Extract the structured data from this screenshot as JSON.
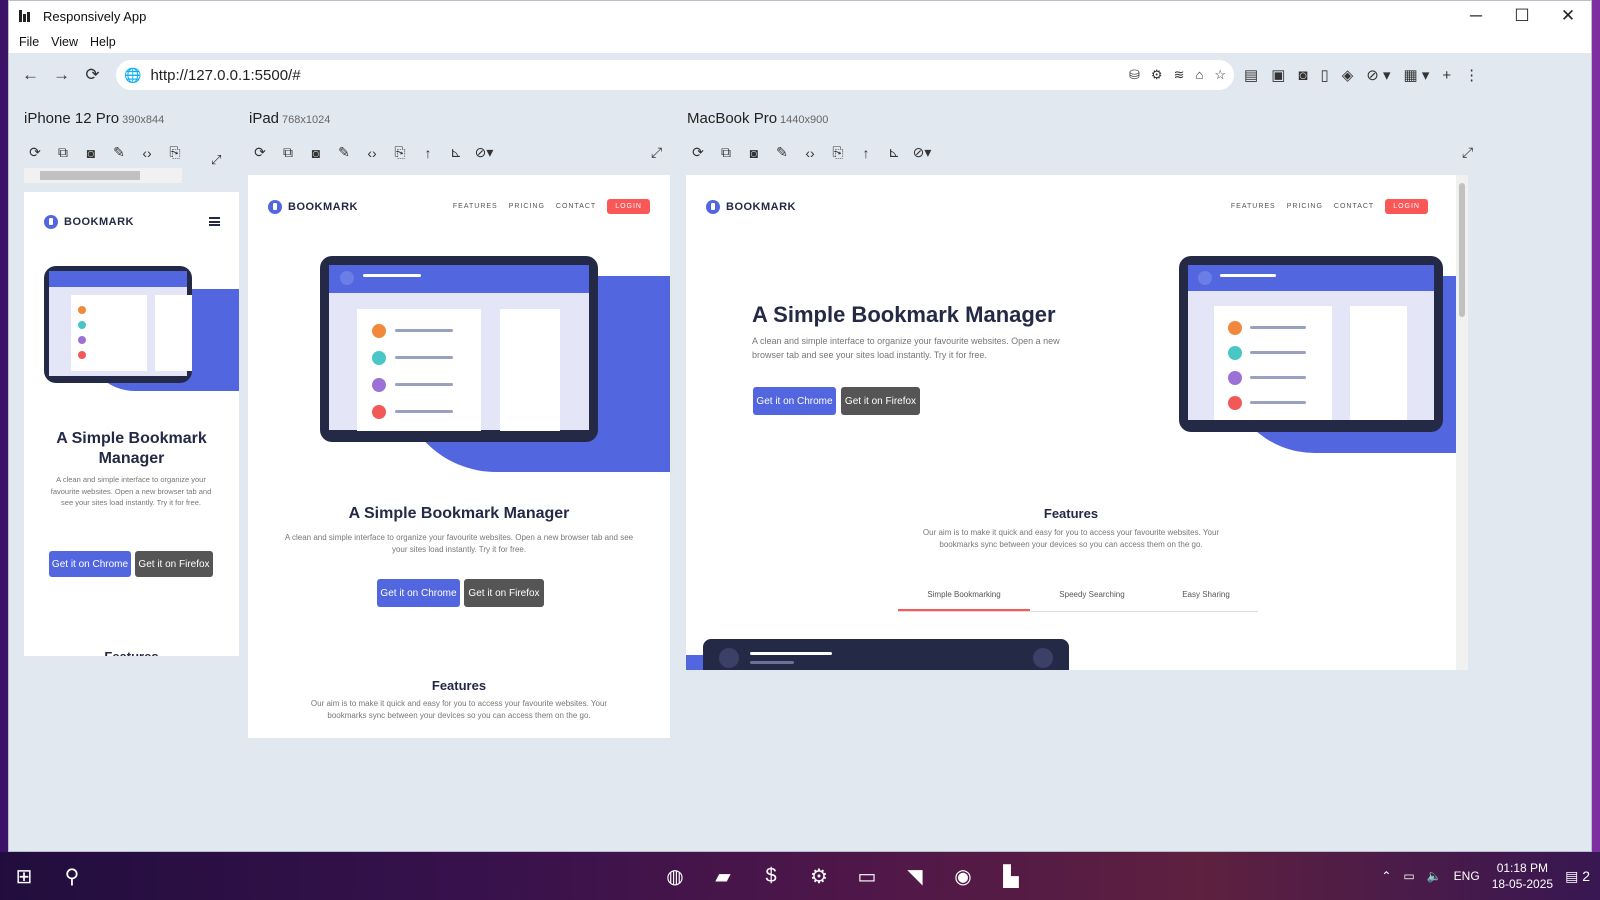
{
  "window": {
    "title": "Responsively App",
    "controls": {
      "minimize": "─",
      "maximize": "☐",
      "close": "✕"
    }
  },
  "menu": [
    "File",
    "View",
    "Help"
  ],
  "toolbar": {
    "back": "←",
    "forward": "→",
    "reload": "⟳",
    "url": "http://127.0.0.1:5500/#"
  },
  "devices": [
    {
      "name": "iPhone 12 Pro",
      "size": "390x844"
    },
    {
      "name": "iPad",
      "size": "768x1024"
    },
    {
      "name": "MacBook Pro",
      "size": "1440x900"
    }
  ],
  "site": {
    "logo": "BOOKMARK",
    "nav": [
      "FEATURES",
      "PRICING",
      "CONTACT"
    ],
    "login": "LOGIN",
    "hero_title": "A Simple Bookmark Manager",
    "hero_text": "A clean and simple interface to organize your favourite websites. Open a new browser tab and see your sites load instantly. Try it for free.",
    "btn_chrome": "Get it on Chrome",
    "btn_firefox": "Get it on Firefox",
    "features_title": "Features",
    "features_text": "Our aim is to make it quick and easy for you to access your favourite websites. Your bookmarks sync between your devices so you can access them on the go.",
    "tabs": [
      "Simple Bookmarking",
      "Speedy Searching",
      "Easy Sharing"
    ]
  },
  "colors": {
    "accent": "#5267df",
    "red": "#fa5757",
    "dark": "#242a45"
  },
  "taskbar": {
    "lang": "ENG",
    "time": "01:18 PM",
    "date": "18-05-2025",
    "notifications": "2"
  }
}
